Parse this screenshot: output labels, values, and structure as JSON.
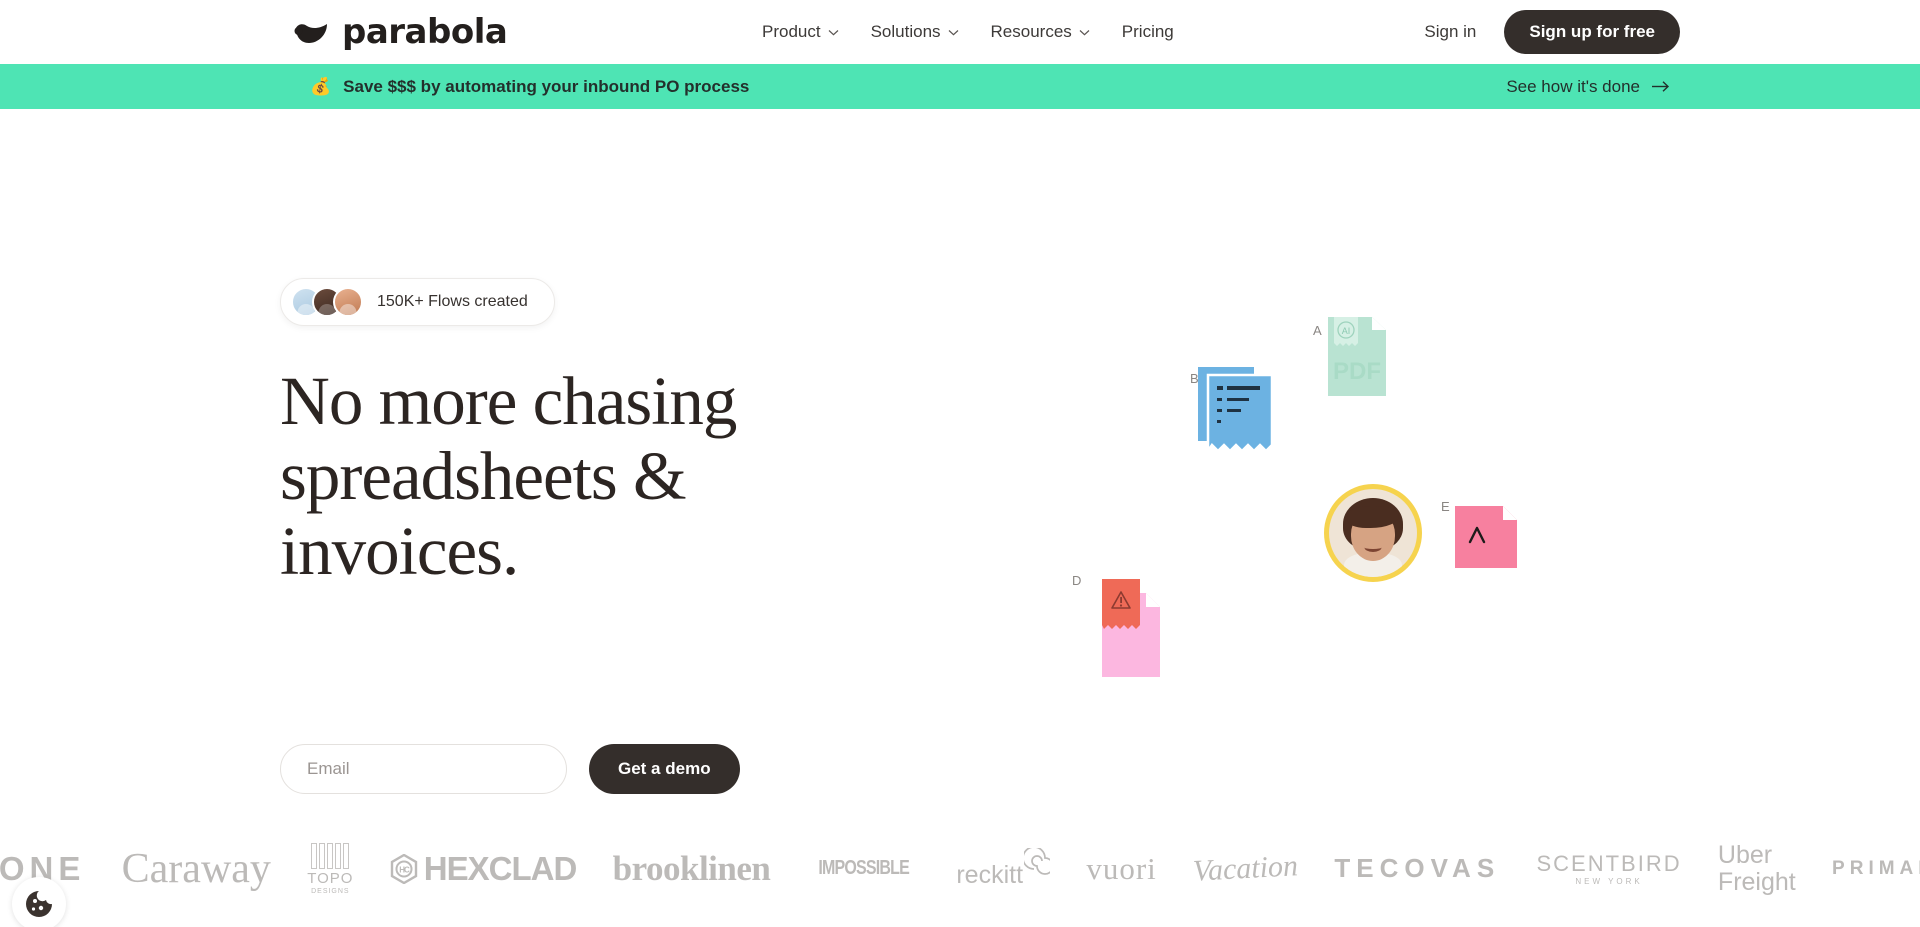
{
  "brand": {
    "name": "parabola",
    "logo_icon": "parabola-swoosh-icon"
  },
  "nav": {
    "items": [
      {
        "label": "Product",
        "has_dropdown": true
      },
      {
        "label": "Solutions",
        "has_dropdown": true
      },
      {
        "label": "Resources",
        "has_dropdown": true
      },
      {
        "label": "Pricing",
        "has_dropdown": false
      }
    ],
    "sign_in": "Sign in",
    "sign_up": "Sign up for free"
  },
  "banner": {
    "emoji": "💰",
    "text": "Save $$$ by automating your inbound PO process",
    "cta": "See how it's done",
    "bg_color": "#4ee4b4",
    "text_color": "#23302c"
  },
  "hero": {
    "pill_text": "150K+ Flows created",
    "headline_line1": "No more chasing",
    "headline_line2": "spreadsheets &",
    "headline_line3": "invoices.",
    "email_placeholder": "Email",
    "email_value": "",
    "cta_label": "Get a demo",
    "art": {
      "label_a": "A",
      "label_b": "B",
      "label_d": "D",
      "label_e": "E",
      "pdf_text": "PDF",
      "ai_text": "AI",
      "colors": {
        "pdf_card": "#b9e3d2",
        "receipt_blue": "#6cb2e2",
        "doc_pink": "#fcb7e0",
        "warning_red": "#ef6a57",
        "card_pink": "#f7809f",
        "avatar_ring": "#f6d34e"
      }
    }
  },
  "logos": {
    "items": [
      {
        "name": "HONE",
        "id": "hone"
      },
      {
        "name": "Caraway",
        "id": "caraway"
      },
      {
        "name": "TOPO",
        "sub": "DESIGNS",
        "id": "topo"
      },
      {
        "name": "HEXCLAD",
        "id": "hexclad"
      },
      {
        "name": "brooklinen",
        "id": "brooklinen"
      },
      {
        "name": "IMPOSSIBLE",
        "id": "impossible"
      },
      {
        "name": "reckitt",
        "id": "reckitt"
      },
      {
        "name": "vuori",
        "id": "vuori"
      },
      {
        "name": "Vacation",
        "id": "vacation"
      },
      {
        "name": "TECOVAS",
        "id": "tecovas"
      },
      {
        "name": "SCENTBIRD",
        "sub": "NEW YORK",
        "id": "scentbird"
      },
      {
        "name": "Uber",
        "sub": "Freight",
        "id": "uber-freight"
      },
      {
        "name": "PRIMARY",
        "id": "primary"
      }
    ]
  },
  "cookie_widget": {
    "icon": "cookie-icon"
  },
  "theme": {
    "dark": "#342e2b",
    "accent_green": "#4ee4b4",
    "muted": "#bcbab8"
  }
}
